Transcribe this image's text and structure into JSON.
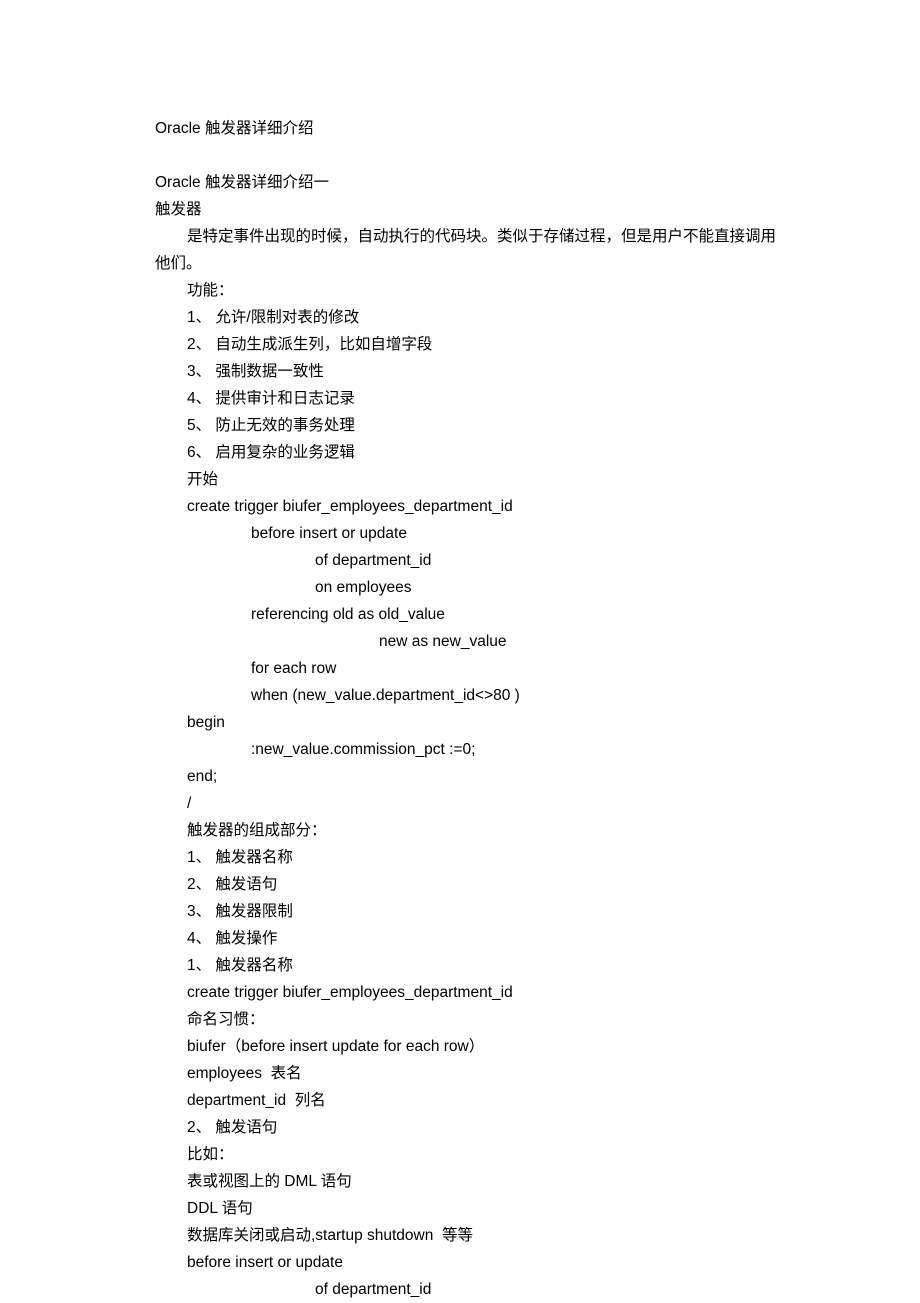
{
  "title_main": "Oracle 触发器详细介绍",
  "title_section": "Oracle 触发器详细介绍一",
  "trigger_heading": "触发器",
  "intro_line1": "是特定事件出现的时候，自动执行的代码块。类似于存储过程，但是用户不能直接调用",
  "intro_line2": "他们。",
  "functions_label": "功能：",
  "func1": "1、 允许/限制对表的修改",
  "func2": "2、 自动生成派生列，比如自增字段",
  "func3": "3、 强制数据一致性",
  "func4": "4、 提供审计和日志记录",
  "func5": "5、 防止无效的事务处理",
  "func6": "6、 启用复杂的业务逻辑",
  "start_label": "开始",
  "code_line1": "create trigger biufer_employees_department_id",
  "code_line2": "before insert or update",
  "code_line3": "of department_id",
  "code_line4": "on employees",
  "code_line5": "referencing old as old_value",
  "code_line6": "new as new_value",
  "code_line7": "for each row",
  "code_line8": "when (new_value.department_id<>80 )",
  "code_line9": "begin",
  "code_line10": ":new_value.commission_pct :=0;",
  "code_line11": "end;",
  "code_line12": "/",
  "components_label": "触发器的组成部分：",
  "comp1": "1、 触发器名称",
  "comp2": "2、 触发语句",
  "comp3": "3、 触发器限制",
  "comp4": "4、 触发操作",
  "comp1_repeat": "1、 触发器名称",
  "create_line": "create trigger biufer_employees_department_id",
  "naming_label": "命名习惯：",
  "biufer_line": "biufer（before insert update for each row）",
  "employees_line": "employees  表名",
  "department_line": "department_id  列名",
  "comp2_repeat": "2、 触发语句",
  "example_label": "比如：",
  "dml_line": "表或视图上的 DML 语句",
  "ddl_line": "DDL 语句",
  "db_line": "数据库关闭或启动,startup shutdown  等等",
  "before_line": "before insert or update",
  "of_line": "of department_id"
}
